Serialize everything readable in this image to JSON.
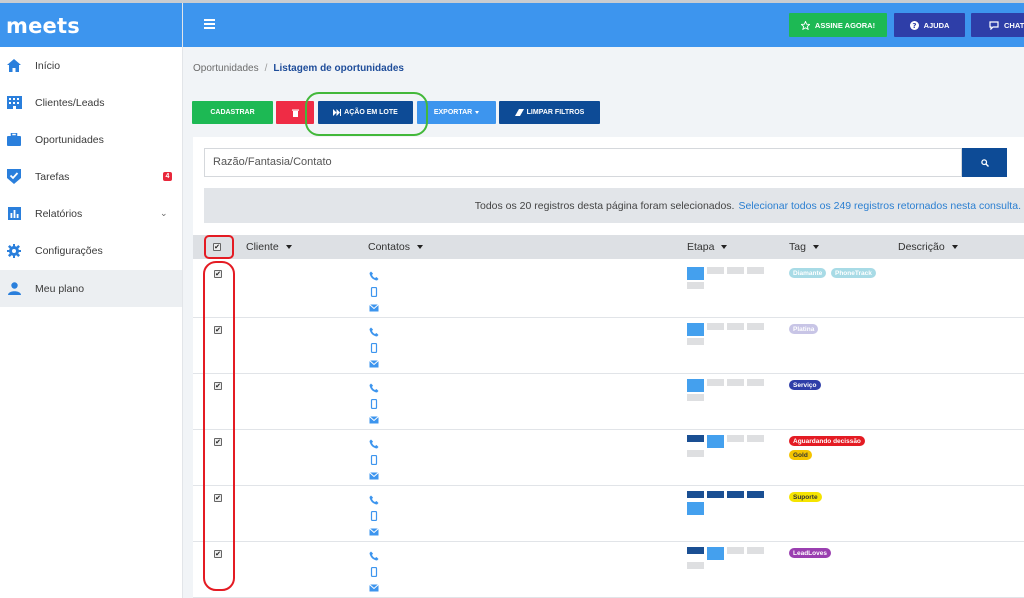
{
  "brand": "meets",
  "sidebar": {
    "items": [
      {
        "label": "Início",
        "icon": "home-icon"
      },
      {
        "label": "Clientes/Leads",
        "icon": "building-icon"
      },
      {
        "label": "Oportunidades",
        "icon": "briefcase-icon"
      },
      {
        "label": "Tarefas",
        "icon": "check-shield-icon",
        "badge": "4"
      },
      {
        "label": "Relatórios",
        "icon": "bar-chart-icon"
      },
      {
        "label": "Configurações",
        "icon": "gear-icon"
      },
      {
        "label": "Meu plano",
        "icon": "user-icon",
        "active": true
      }
    ]
  },
  "header": {
    "subscribe_label": "ASSINE AGORA!",
    "help_label": "AJUDA",
    "chat_label": "CHAT"
  },
  "breadcrumb": {
    "parent": "Oportunidades",
    "separator": "/",
    "current": "Listagem de oportunidades"
  },
  "toolbar": {
    "cadastrar_label": "CADASTRAR",
    "acao_lote_label": "AÇÃO EM LOTE",
    "exportar_label": "EXPORTAR",
    "limpar_label": "LIMPAR FILTROS"
  },
  "search": {
    "placeholder": "Razão/Fantasia/Contato"
  },
  "notice": {
    "text": "Todos os 20 registros desta página foram selecionados.",
    "link": "Selecionar todos os 249 registros retornados nesta consulta."
  },
  "table": {
    "columns": [
      "Cliente",
      "Contatos",
      "Etapa",
      "Tag",
      "Descrição"
    ],
    "rows": [
      {
        "checked": true,
        "stage": 1,
        "tags": [
          {
            "label": "Diamante",
            "color": "#a8dbe6"
          },
          {
            "label": "PhoneTrack",
            "color": "#a8dbe6"
          }
        ]
      },
      {
        "checked": true,
        "stage": 1,
        "tags": [
          {
            "label": "Platina",
            "color": "#c8c5e6"
          }
        ]
      },
      {
        "checked": true,
        "stage": 1,
        "tags": [
          {
            "label": "Serviço",
            "color": "#2e3ea8"
          }
        ]
      },
      {
        "checked": true,
        "stage": 2,
        "tags": [
          {
            "label": "Aguardando decissão",
            "color": "#e41b23"
          },
          {
            "label": "Gold",
            "color": "#f5c400"
          }
        ]
      },
      {
        "checked": true,
        "stage": 5,
        "tags": [
          {
            "label": "Suporte",
            "color": "#f5e400"
          }
        ]
      },
      {
        "checked": true,
        "stage": 2,
        "tags": [
          {
            "label": "LeadLoves",
            "color": "#9a3fb0"
          }
        ]
      }
    ]
  },
  "colors": {
    "primary": "#3d95ee",
    "dark_blue": "#0d4b96",
    "green": "#1db954",
    "red": "#ef2c45",
    "annotation_green": "#43b83a",
    "annotation_red": "#e41b23"
  }
}
